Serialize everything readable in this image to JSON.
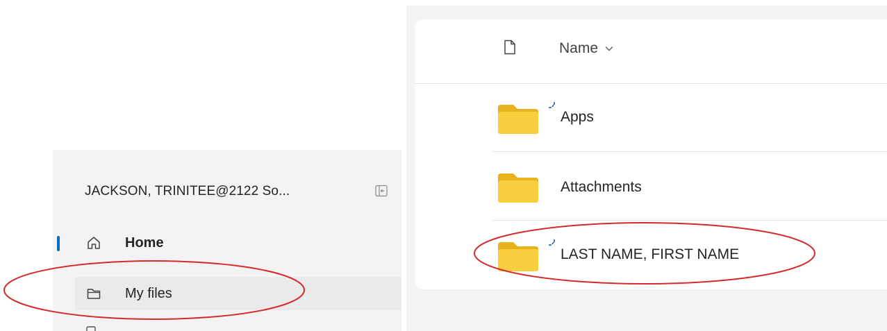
{
  "sidebar": {
    "account_name": "JACKSON, TRINITEE@2122 So...",
    "nav": [
      {
        "label": "Home",
        "icon": "home-icon",
        "selected": true
      },
      {
        "label": "My files",
        "icon": "folder-icon",
        "highlighted": true
      }
    ]
  },
  "file_list": {
    "column_header": "Name",
    "items": [
      {
        "name": "Apps",
        "icon": "folder-icon",
        "sync_indicator": true
      },
      {
        "name": "Attachments",
        "icon": "folder-icon",
        "sync_indicator": false
      },
      {
        "name": "LAST NAME, FIRST NAME",
        "icon": "folder-icon",
        "sync_indicator": true,
        "highlighted": true
      }
    ]
  },
  "colors": {
    "accent": "#0f6cbd",
    "folder": "#f8cf3e",
    "annotation_ellipse": "#d42a2a",
    "sidebar_bg": "#f3f3f3"
  }
}
